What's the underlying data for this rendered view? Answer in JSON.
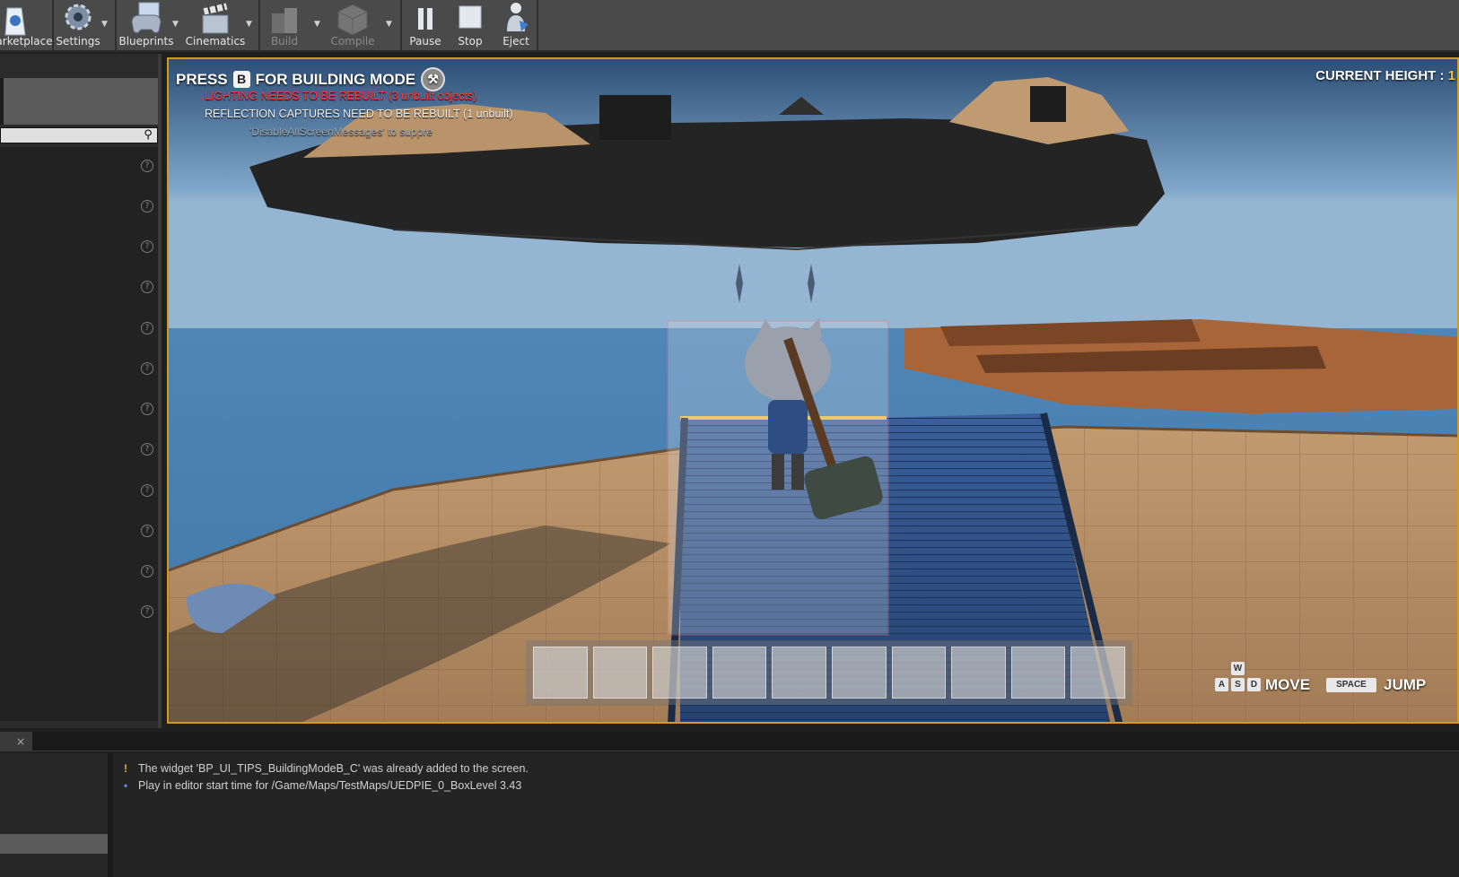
{
  "toolbar": {
    "buttons": [
      {
        "label": "arketplace",
        "icon": "marketplace-icon",
        "enabled": true
      },
      {
        "label": "Settings",
        "icon": "gear-icon",
        "enabled": true
      },
      {
        "label": "Blueprints",
        "icon": "blueprint-gamepad-icon",
        "enabled": true
      },
      {
        "label": "Cinematics",
        "icon": "clapperboard-icon",
        "enabled": true
      },
      {
        "label": "Build",
        "icon": "build-blocks-icon",
        "enabled": false
      },
      {
        "label": "Compile",
        "icon": "compile-cube-icon",
        "enabled": false
      },
      {
        "label": "Pause",
        "icon": "pause-icon",
        "enabled": true
      },
      {
        "label": "Stop",
        "icon": "stop-icon",
        "enabled": true
      },
      {
        "label": "Eject",
        "icon": "eject-icon",
        "enabled": true
      }
    ]
  },
  "hud": {
    "press_prefix": "PRESS",
    "press_key": "B",
    "press_suffix": "FOR BUILDING MODE",
    "current_height_label": "CURRENT HEIGHT :",
    "current_height_value": "1",
    "messages": {
      "lighting": "LIGHTING NEEDS TO BE REBUILT (3 unbuilt objects)",
      "reflection": "REFLECTION CAPTURES NEED TO BE REBUILT (1 unbuilt)",
      "disable": "'DisableAllScreenMessages' to suppre"
    },
    "controls": {
      "keys": {
        "w": "W",
        "a": "A",
        "s": "S",
        "d": "D"
      },
      "move_label": "MOVE",
      "space_key": "SPACE",
      "jump_label": "JUMP"
    },
    "hotbar_slots": 10
  },
  "output_log": {
    "lines": [
      {
        "type": "warning",
        "marker": "!",
        "text": "The widget 'BP_UI_TIPS_BuildingModeB_C' was already added to the screen."
      },
      {
        "type": "info",
        "marker": "•",
        "text": "Play in editor start time for /Game/Maps/TestMaps/UEDPIE_0_BoxLevel 3.43"
      }
    ]
  },
  "bottom_tab": {
    "close": "×"
  },
  "colors": {
    "toolbar_bg": "#4a4a4a",
    "viewport_border": "#d39a1c",
    "warning_red": "#ff3b3b",
    "warning_yellow": "#e7b23a",
    "info_blue": "#5a8ed8",
    "height_value": "#f0c24b"
  }
}
